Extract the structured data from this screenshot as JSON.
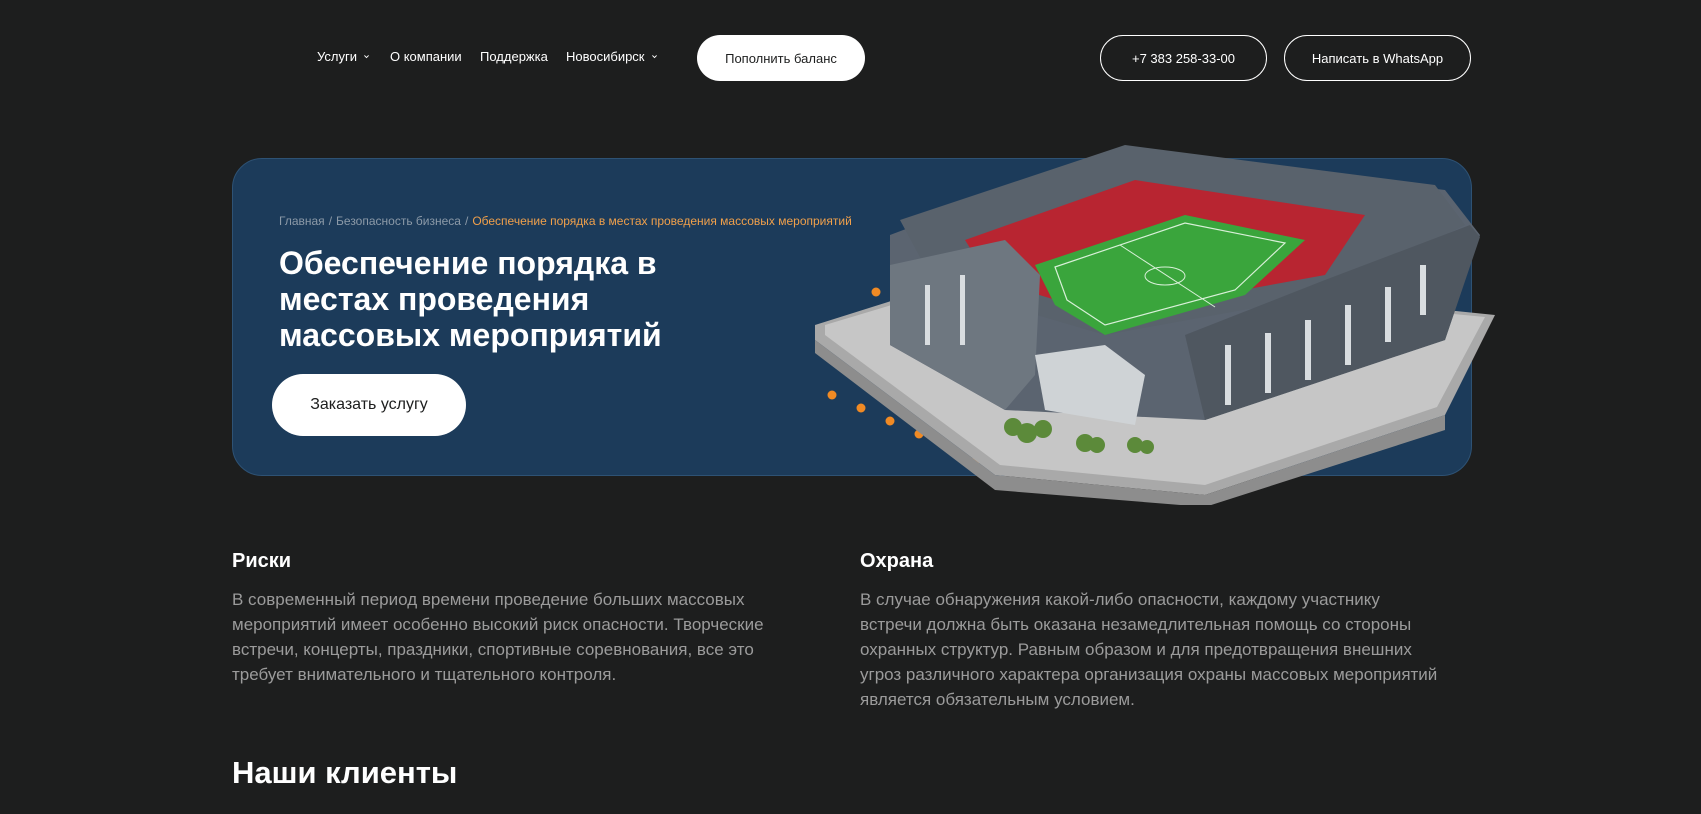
{
  "nav": {
    "services": "Услуги",
    "about": "О компании",
    "support": "Поддержка",
    "city": "Новосибирск",
    "balance_button": "Пополнить баланс",
    "phone": "+7 383 258-33-00",
    "whatsapp_button": "Написать в WhatsApp"
  },
  "hero": {
    "breadcrumb": {
      "home": "Главная",
      "separator": "/",
      "section": "Безопасность бизнеса",
      "current": "Обеспечение порядка в местах проведения массовых мероприятий"
    },
    "title": "Обеспечение порядка  в местах проведения массовых мероприятий",
    "order_button": "Заказать услугу",
    "image_icon": "stadium-illustration"
  },
  "sections": [
    {
      "title": "Риски",
      "text": "В современный период времени проведение больших массовых мероприятий имеет особенно высокий риск опасности. Творческие встречи, концерты, праздники, спортивные соревнования, все это требует внимательного и тщательного контроля."
    },
    {
      "title": "Охрана",
      "text": "В случае обнаружения какой-либо опасности, каждому участнику встречи должна быть оказана незамедлительная помощь со стороны охранных структур. Равным образом и для предотвращения внешних угроз различного характера организация охраны массовых мероприятий является обязательным условием."
    }
  ],
  "clients_title": "Наши клиенты",
  "colors": {
    "background": "#1d1e1e",
    "hero": "#1c3b5a",
    "accent": "#f0a04b",
    "muted_text": "#9b9b9b"
  }
}
